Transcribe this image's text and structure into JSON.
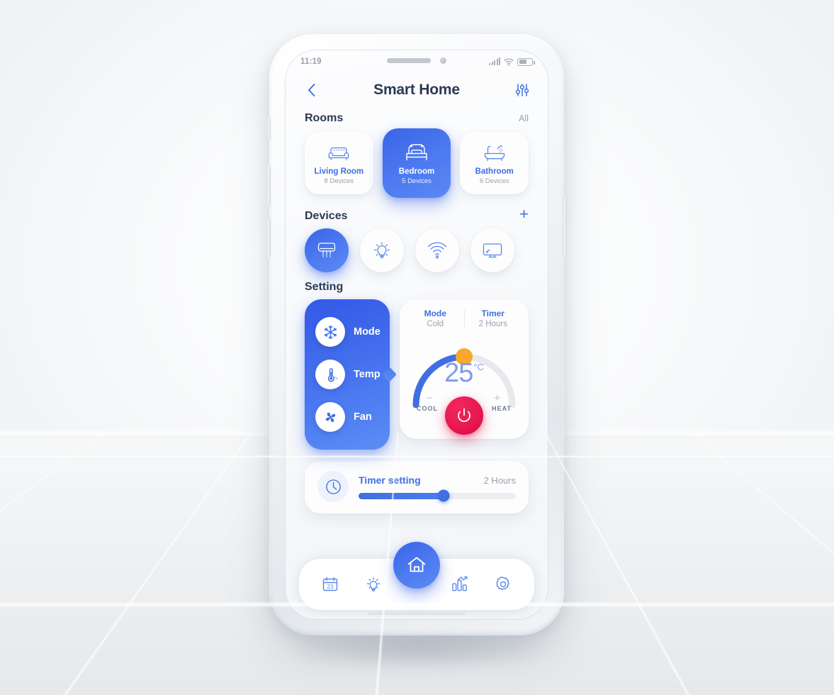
{
  "status_bar": {
    "time": "11:19",
    "signal_icon": "signal-bars-icon",
    "wifi_icon": "wifi-icon",
    "battery_icon": "battery-icon",
    "battery_level": 62
  },
  "header": {
    "back_icon": "chevron-left-icon",
    "title": "Smart Home",
    "filter_icon": "sliders-icon"
  },
  "rooms_section": {
    "title": "Rooms",
    "action_label": "All",
    "items": [
      {
        "name": "Living Room",
        "devices": "8 Devices",
        "icon": "sofa-icon",
        "active": false
      },
      {
        "name": "Bedroom",
        "devices": "5 Devices",
        "icon": "bed-icon",
        "active": true
      },
      {
        "name": "Bathroom",
        "devices": "6 Devices",
        "icon": "bathtub-icon",
        "active": false
      }
    ]
  },
  "devices_section": {
    "title": "Devices",
    "add_label": "+",
    "items": [
      {
        "icon": "air-conditioner-icon",
        "active": true
      },
      {
        "icon": "lightbulb-icon",
        "active": false
      },
      {
        "icon": "wifi-router-icon",
        "active": false
      },
      {
        "icon": "smart-tv-icon",
        "active": false
      }
    ]
  },
  "setting_section": {
    "title": "Setting",
    "modes": [
      {
        "label": "Mode",
        "icon": "snowflake-icon"
      },
      {
        "label": "Temp",
        "icon": "thermometer-icon"
      },
      {
        "label": "Fan",
        "icon": "fan-icon"
      }
    ],
    "thermostat": {
      "mode_key": "Mode",
      "mode_value": "Cold",
      "timer_key": "Timer",
      "timer_value": "2 Hours",
      "temperature": "25",
      "unit": "°C",
      "minus_sign": "−",
      "plus_sign": "+",
      "cool_label": "COOL",
      "heat_label": "HEAT",
      "power_icon": "power-icon",
      "arc_percent": 50,
      "arc_active_color": "#3f6fe0",
      "arc_track_color": "#e7e9ec",
      "knob_color": "#f7a82e",
      "power_color": "#e8194f"
    }
  },
  "timer_card": {
    "icon": "clock-icon",
    "label": "Timer setting",
    "value": "2 Hours",
    "slider_percent": 54
  },
  "bottom_nav": {
    "items": [
      {
        "icon": "calendar-icon",
        "badge": "23"
      },
      {
        "icon": "lightbulb-idea-icon"
      },
      {
        "icon": "home-icon",
        "primary": true
      },
      {
        "icon": "bar-chart-icon"
      },
      {
        "icon": "gear-icon"
      }
    ]
  },
  "theme": {
    "primary": "#3f6fe0",
    "primary_dark": "#3358e6",
    "accent_orange": "#f7a82e",
    "accent_red": "#e8194f",
    "text_dark": "#2b3a55",
    "text_muted": "#9aa1ab"
  }
}
